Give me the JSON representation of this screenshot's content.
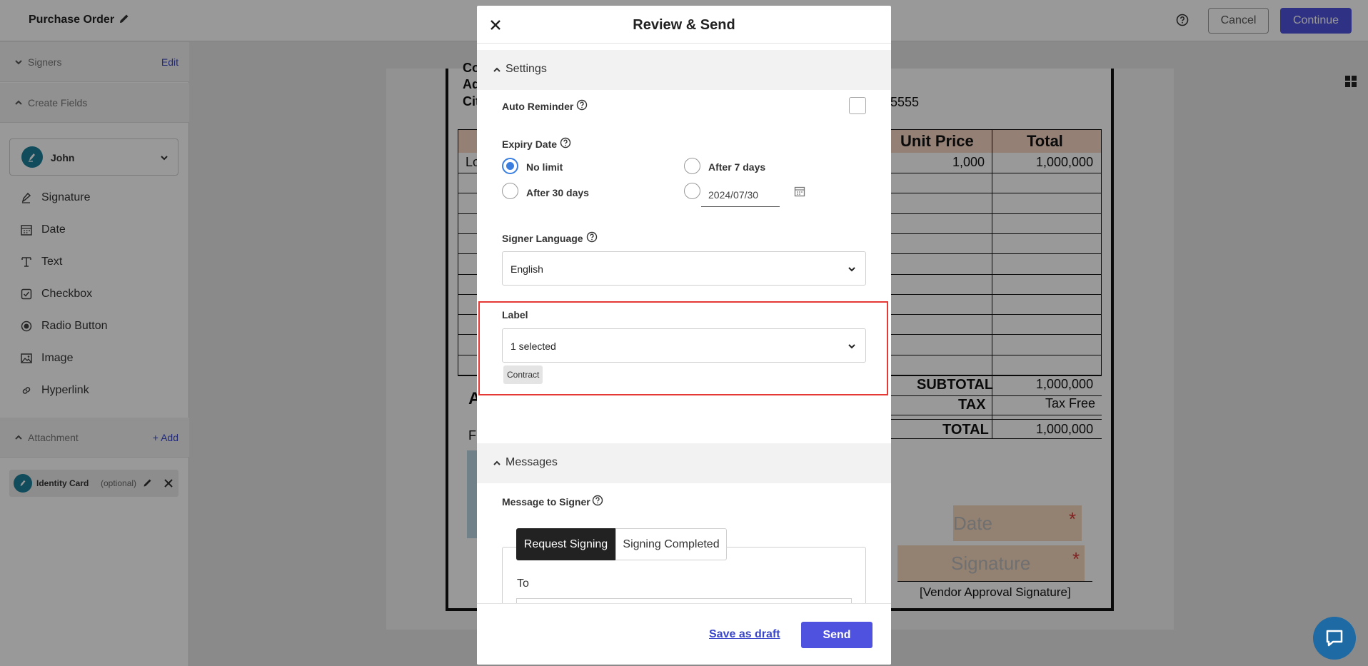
{
  "topbar": {
    "title": "Purchase Order",
    "cancel_label": "Cancel",
    "continue_label": "Continue"
  },
  "sidebar": {
    "signers": {
      "label": "Signers",
      "action": "Edit"
    },
    "create_fields": {
      "label": "Create Fields"
    },
    "selected_signer": "John",
    "fields": [
      {
        "label": "Signature",
        "icon": "signature-pen-icon"
      },
      {
        "label": "Date",
        "icon": "calendar-icon"
      },
      {
        "label": "Text",
        "icon": "text-icon"
      },
      {
        "label": "Checkbox",
        "icon": "checkbox-icon"
      },
      {
        "label": "Radio Button",
        "icon": "radio-icon"
      },
      {
        "label": "Image",
        "icon": "image-icon"
      },
      {
        "label": "Hyperlink",
        "icon": "link-icon"
      }
    ],
    "attachment": {
      "label": "Attachment",
      "action": "+ Add"
    },
    "attachment_item": {
      "name": "Identity Card",
      "note": "(optional)"
    }
  },
  "document": {
    "partial_lines": [
      "Co",
      "Ad",
      "Cit"
    ],
    "phone_suffix": "5555",
    "columns": [
      "Unit Price",
      "Total"
    ],
    "first_row": {
      "prefix": "Lo",
      "unit_price": "1,000",
      "total": "1,000,000"
    },
    "summary": [
      {
        "label": "SUBTOTAL",
        "value": "1,000,000"
      },
      {
        "label": "TAX",
        "value": "Tax Free"
      },
      {
        "label": "TOTAL",
        "value": "1,000,000"
      }
    ],
    "partial_a": "A",
    "partial_f": "Fr",
    "date_field": "Date",
    "signature_field": "Signature",
    "required_mark": "*",
    "vendor_caption": "[Vendor Approval Signature]"
  },
  "modal": {
    "title": "Review & Send",
    "settings_label": "Settings",
    "auto_reminder_label": "Auto Reminder",
    "auto_reminder_checked": false,
    "expiry_label": "Expiry Date",
    "expiry_options": [
      "No limit",
      "After 7 days",
      "After 30 days"
    ],
    "expiry_selected": "No limit",
    "expiry_custom_date": "2024/07/30",
    "signer_language_label": "Signer Language",
    "signer_language_value": "English",
    "label_label": "Label",
    "label_value": "1 selected",
    "label_chip": "Contract",
    "messages_label": "Messages",
    "message_to_signer_label": "Message to Signer",
    "tabs": [
      "Request Signing",
      "Signing Completed"
    ],
    "active_tab": "Request Signing",
    "to_label": "To",
    "save_draft_label": "Save as draft",
    "send_label": "Send"
  },
  "colors": {
    "accent": "#4f52de",
    "highlight_border": "#e53935",
    "radio_selected": "#3a7fe0",
    "avatar": "#1c7f9a",
    "field_fill": "#f6d8bf"
  }
}
